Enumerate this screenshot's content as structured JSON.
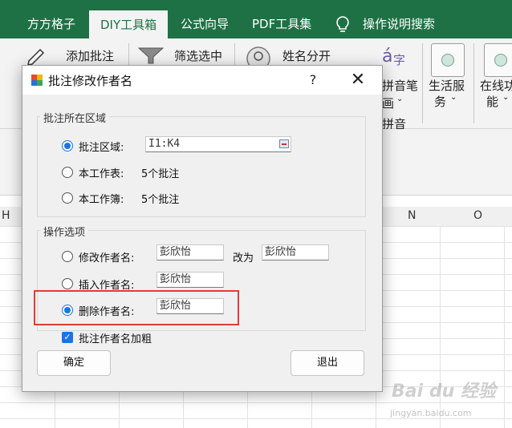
{
  "ribbon": {
    "tabs": [
      {
        "label": "方方格子"
      },
      {
        "label": "DIY工具箱",
        "active": true
      },
      {
        "label": "公式向导"
      },
      {
        "label": "PDF工具集"
      },
      {
        "label": "操作说明搜索"
      }
    ],
    "buttons": {
      "add_comment": "添加批注",
      "filter_selected": "筛选选中",
      "split_name": "姓名分开",
      "pinyin_line1": "拼音笔",
      "pinyin_line2": "画",
      "pinyin_group": "拼音",
      "life_line1": "生活服",
      "life_line2": "务",
      "online_line1": "在线功",
      "online_line2": "能"
    },
    "colors": {
      "tab_bar": "#1e7145",
      "accent": "#1a73e8",
      "highlight": "#e23b3b"
    }
  },
  "sheet": {
    "column_headers": [
      "H",
      "N",
      "O"
    ]
  },
  "dialog": {
    "title": "批注修改作者名",
    "help_glyph": "?",
    "close_glyph": "✕",
    "region_group": {
      "legend": "批注所在区域",
      "options": [
        {
          "label": "批注区域:",
          "value": "I1:K4",
          "selected": true
        },
        {
          "label": "本工作表:",
          "value": "5个批注",
          "selected": false
        },
        {
          "label": "本工作簿:",
          "value": "5个批注",
          "selected": false
        }
      ]
    },
    "ops_group": {
      "legend": "操作选项",
      "modify": {
        "label": "修改作者名:",
        "from": "彭欣怡",
        "to_label": "改为",
        "to": "彭欣怡",
        "selected": false
      },
      "insert": {
        "label": "插入作者名:",
        "value": "彭欣怡",
        "selected": false
      },
      "delete": {
        "label": "删除作者名:",
        "value": "彭欣怡",
        "selected": true
      }
    },
    "bold_checkbox": {
      "label": "批注作者名加粗",
      "checked": true
    },
    "ok_label": "确定",
    "exit_label": "退出"
  },
  "watermark": {
    "text": "Bai du 经验",
    "sub": "jingyan.baidu.com"
  }
}
